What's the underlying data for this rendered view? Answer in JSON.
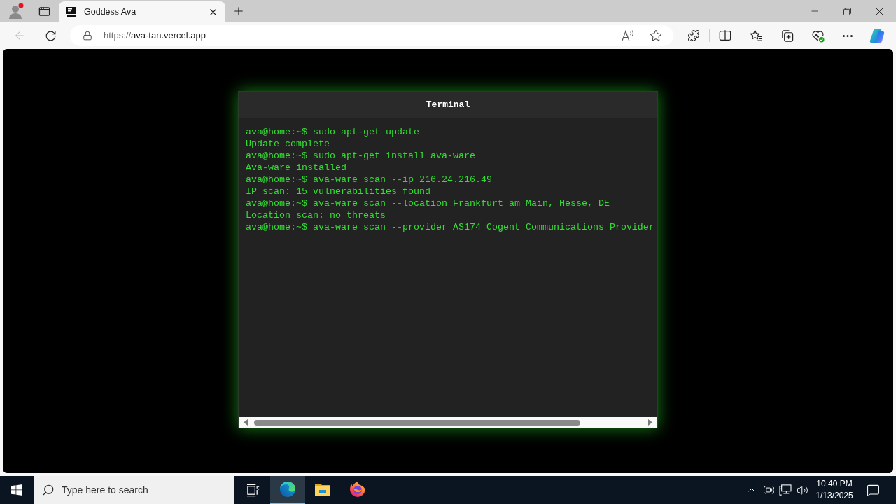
{
  "browser": {
    "tabs": [
      {
        "title": "Goddess Ava",
        "selected": true
      }
    ],
    "back_button": {
      "disabled": true
    },
    "url": {
      "scheme": "https://",
      "host": "ava-tan.vercel.app"
    }
  },
  "terminal": {
    "title": "Terminal",
    "lines": [
      "ava@home:~$ sudo apt-get update",
      "Update complete",
      "ava@home:~$ sudo apt-get install ava-ware",
      "Ava-ware installed",
      "ava@home:~$ ava-ware scan --ip 216.24.216.49",
      "IP scan: 15 vulnerabilities found",
      "ava@home:~$ ava-ware scan --location Frankfurt am Main, Hesse, DE",
      "Location scan: no threats",
      "ava@home:~$ ava-ware scan --provider AS174 Cogent Communications Provider"
    ]
  },
  "taskbar": {
    "search": {
      "placeholder": "Type here to search"
    },
    "apps": [
      {
        "kind": "edge",
        "selected": true
      },
      {
        "kind": "explorer",
        "selected": false
      },
      {
        "kind": "firefox",
        "selected": false
      }
    ],
    "clock": {
      "time": "10:40 PM",
      "date": "1/13/2025"
    }
  }
}
